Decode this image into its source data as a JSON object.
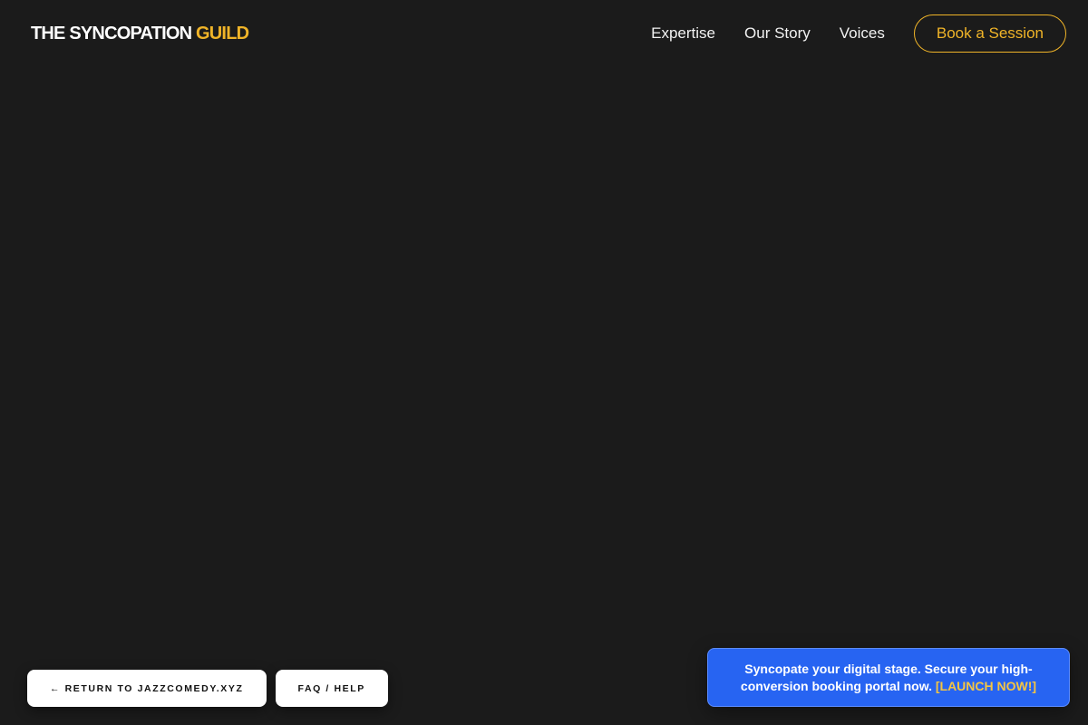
{
  "header": {
    "logo_main": "THE SYNCOPATION ",
    "logo_accent": "GUILD",
    "nav": [
      {
        "label": "Expertise"
      },
      {
        "label": "Our Story"
      },
      {
        "label": "Voices"
      }
    ],
    "cta_label": "Book a Session"
  },
  "footer_buttons": {
    "return_label": "← RETURN TO JAZZCOMEDY.XYZ",
    "faq_label": "FAQ / HELP"
  },
  "promo": {
    "text": "Syncopate your digital stage. Secure your high-conversion booking portal now. ",
    "link_label": "[LAUNCH NOW!]"
  },
  "colors": {
    "background": "#1b1b1b",
    "accent": "#f0b428",
    "promo_blue": "#2764f2"
  }
}
